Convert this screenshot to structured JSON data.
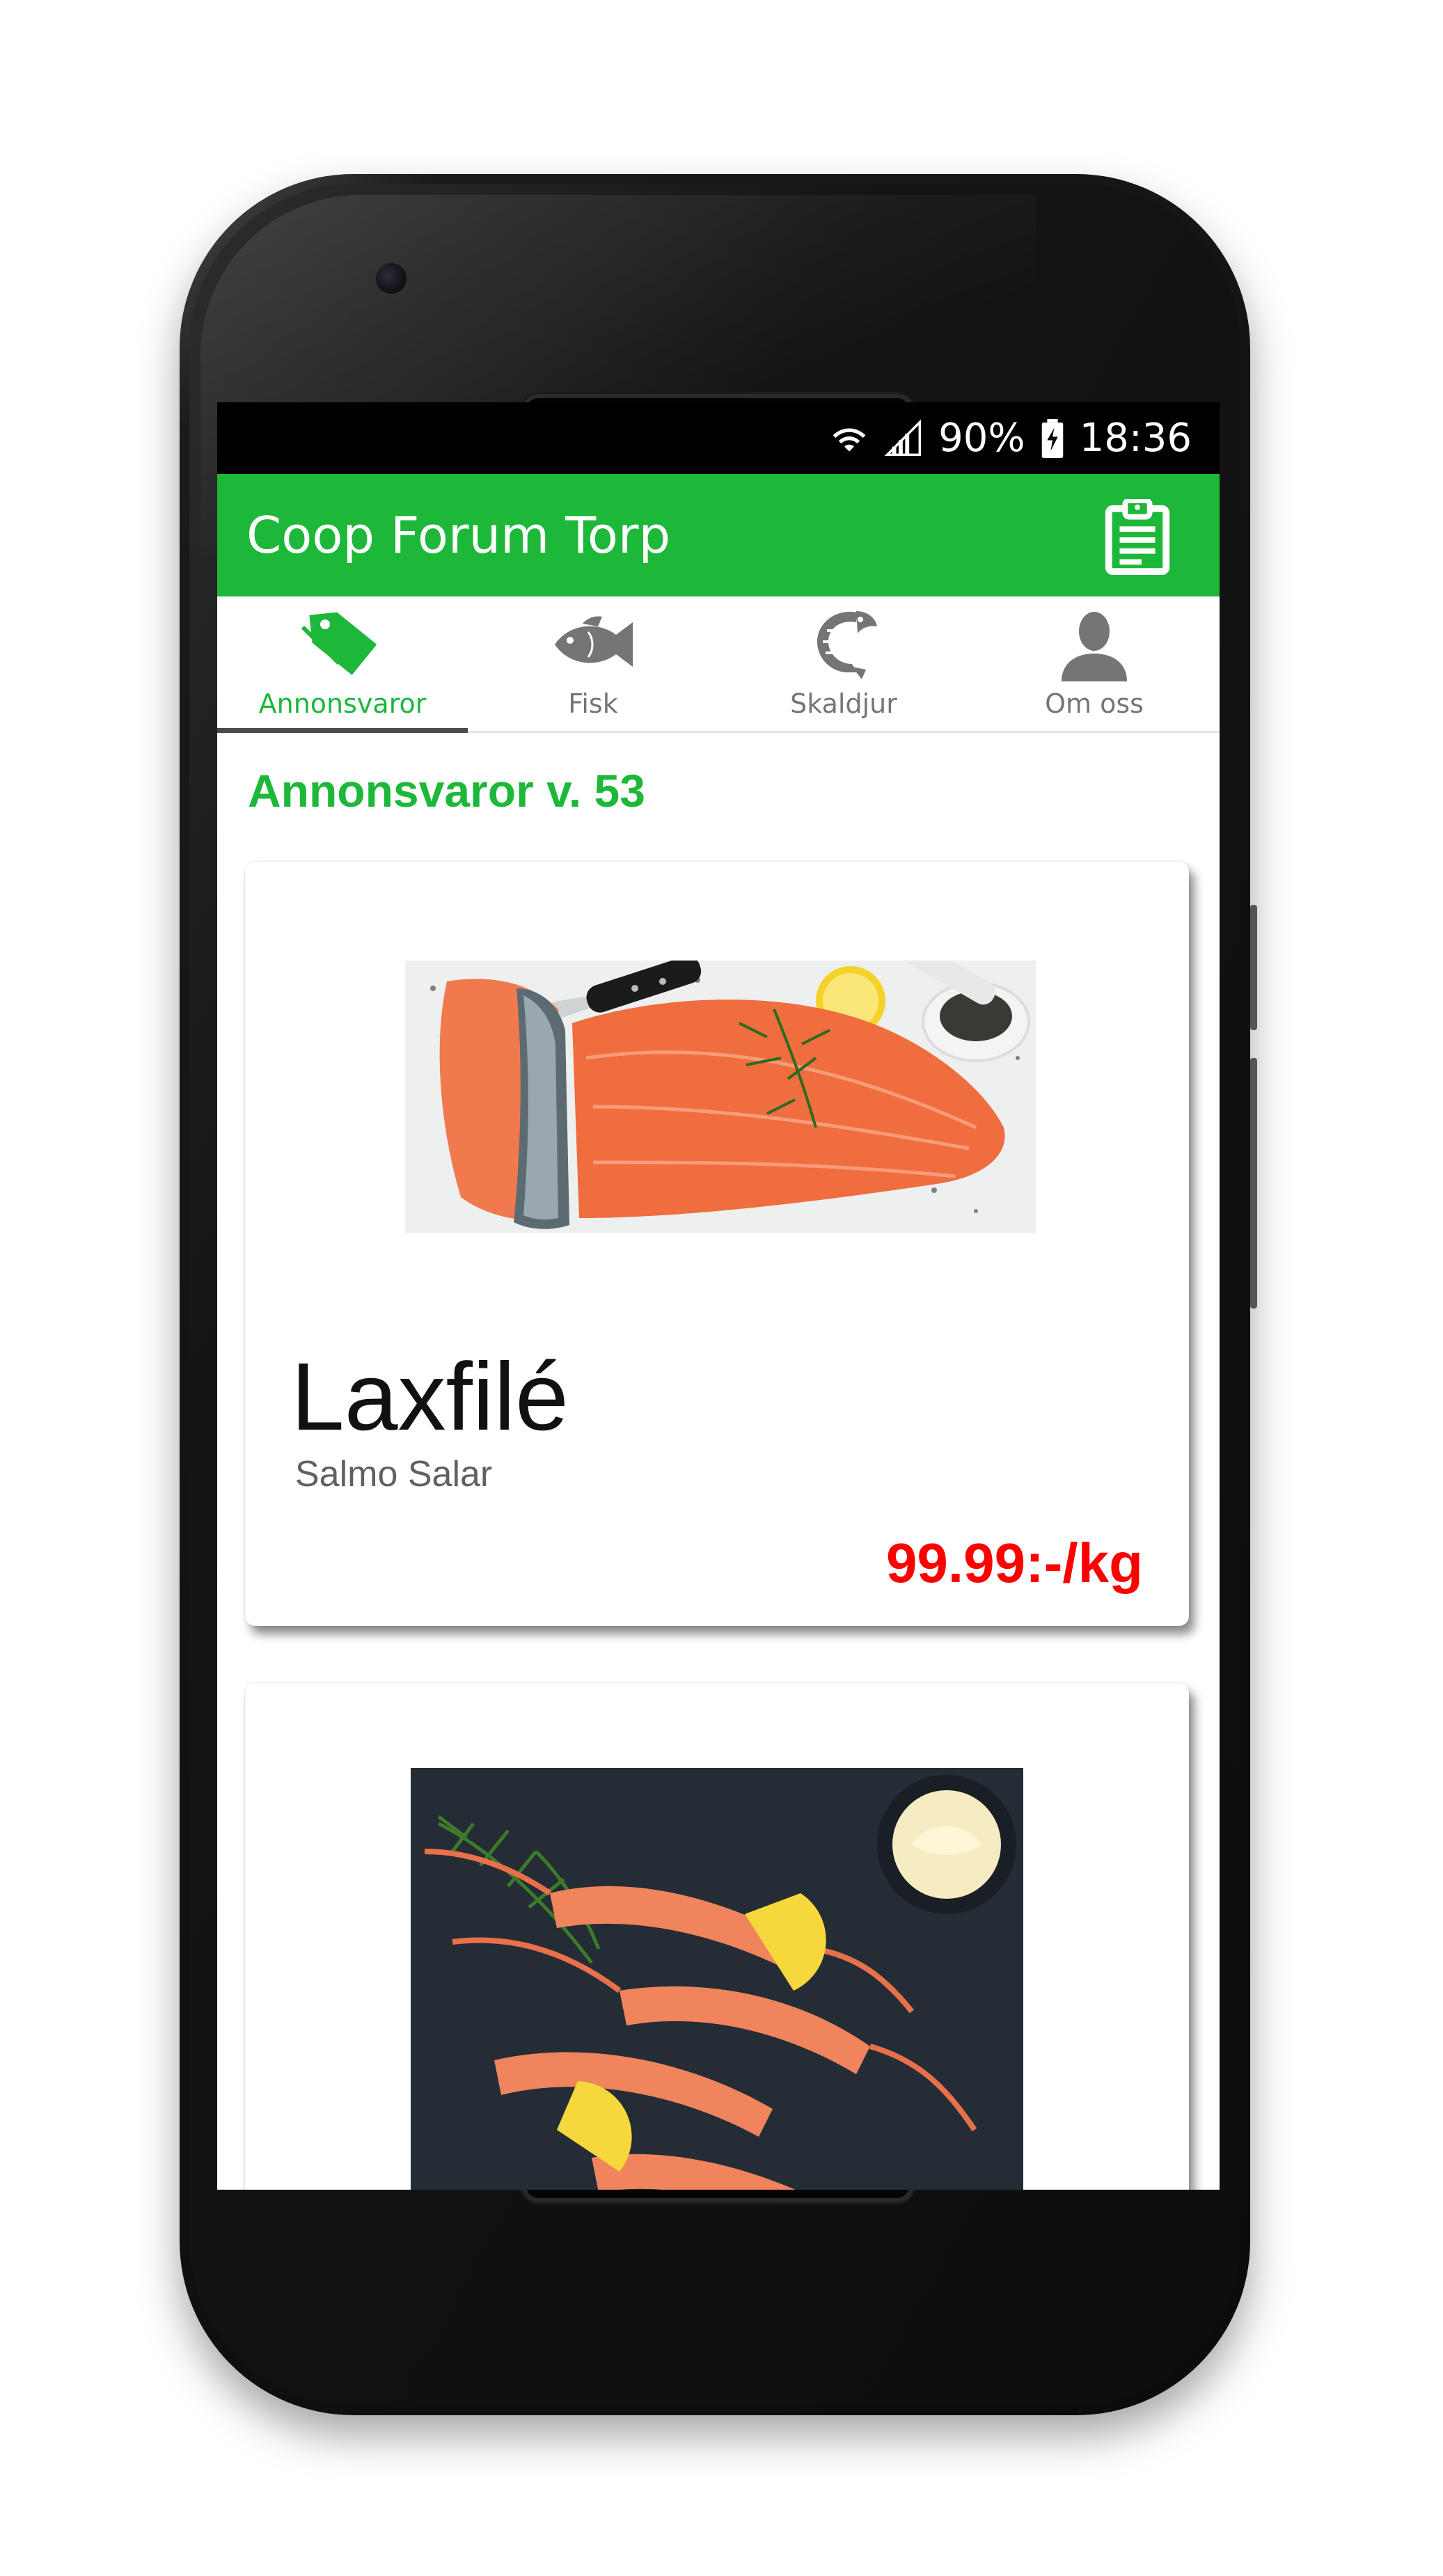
{
  "status_bar": {
    "battery": "90%",
    "time": "18:36"
  },
  "app_bar": {
    "title": "Coop Forum Torp",
    "action_icon": "clipboard-list-icon"
  },
  "tabs": [
    {
      "label": "Annonsvaror",
      "icon": "tag-icon",
      "active": true
    },
    {
      "label": "Fisk",
      "icon": "fish-icon",
      "active": false
    },
    {
      "label": "Skaldjur",
      "icon": "shrimp-icon",
      "active": false
    },
    {
      "label": "Om oss",
      "icon": "person-icon",
      "active": false
    }
  ],
  "section": {
    "title": "Annonsvaror v. 53"
  },
  "products": [
    {
      "name": "Laxfilé",
      "latin": "Salmo Salar",
      "price": "99.99:-/kg",
      "image": "salmon-fillet-photo"
    },
    {
      "image": "langoustines-photo"
    }
  ],
  "colors": {
    "primary": "#1db73a",
    "price": "#ff0000",
    "status_bar": "#000000"
  }
}
